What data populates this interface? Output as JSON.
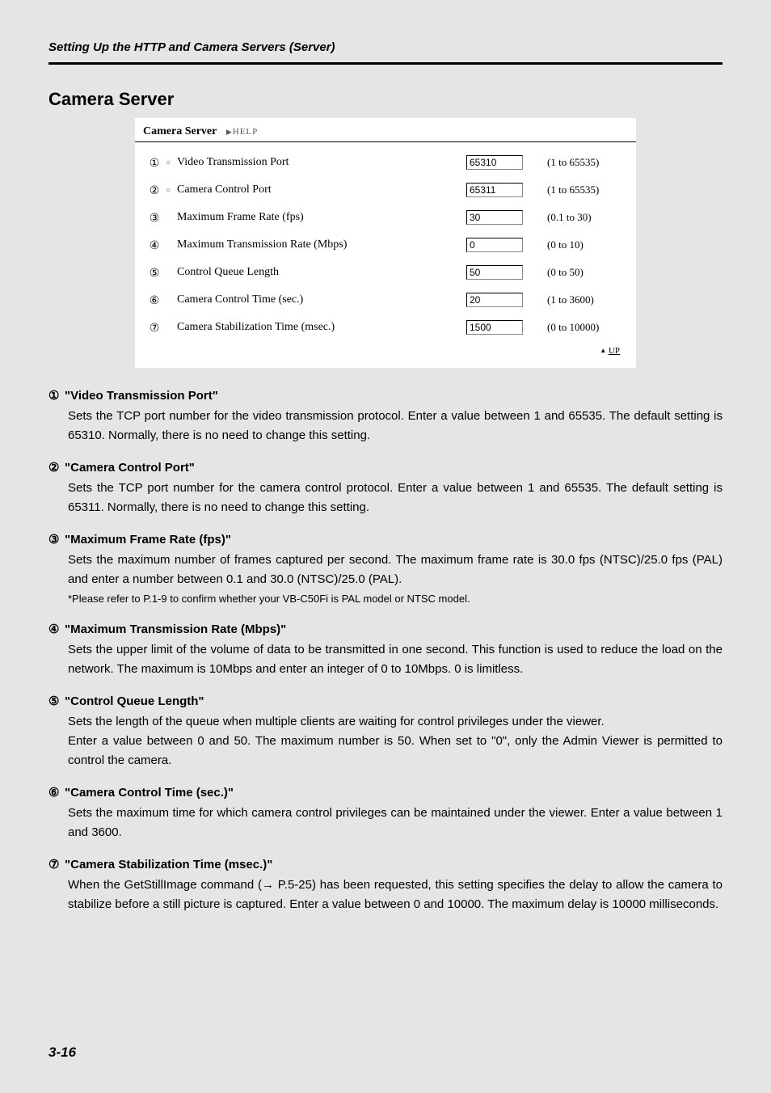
{
  "page": {
    "header": "Setting Up the HTTP and Camera Servers (Server)",
    "section_title": "Camera Server",
    "page_number": "3-16"
  },
  "screenshot": {
    "title": "Camera Server",
    "help_arrow": "▶",
    "help": "HELP",
    "up_arrow": "▲",
    "up": "UP",
    "rows": [
      {
        "num": "①",
        "bullet": "○",
        "label": "Video Transmission Port",
        "value": "65310",
        "range": "(1 to 65535)"
      },
      {
        "num": "②",
        "bullet": "○",
        "label": "Camera Control Port",
        "value": "65311",
        "range": "(1 to 65535)"
      },
      {
        "num": "③",
        "bullet": "",
        "label": "Maximum Frame Rate (fps)",
        "value": "30",
        "range": "(0.1 to 30)"
      },
      {
        "num": "④",
        "bullet": "",
        "label": "Maximum Transmission Rate (Mbps)",
        "value": "0",
        "range": "(0 to 10)"
      },
      {
        "num": "⑤",
        "bullet": "",
        "label": "Control Queue Length",
        "value": "50",
        "range": "(0 to 50)"
      },
      {
        "num": "⑥",
        "bullet": "",
        "label": "Camera Control Time (sec.)",
        "value": "20",
        "range": "(1 to 3600)"
      },
      {
        "num": "⑦",
        "bullet": "",
        "label": "Camera Stabilization Time (msec.)",
        "value": "1500",
        "range": "(0 to 10000)"
      }
    ]
  },
  "descriptions": [
    {
      "num": "①",
      "title": "\"Video Transmission Port\"",
      "body": "Sets the TCP port number for the video transmission protocol. Enter a value between 1 and 65535. The default setting is 65310. Normally, there is no need to change this setting."
    },
    {
      "num": "②",
      "title": "\"Camera Control Port\"",
      "body": "Sets the TCP port number for the camera control protocol. Enter a value between 1 and 65535. The default setting is 65311. Normally, there is no need to change this setting."
    },
    {
      "num": "③",
      "title": "\"Maximum Frame Rate (fps)\"",
      "body": "Sets the maximum number of frames captured per second. The maximum frame rate is 30.0 fps (NTSC)/25.0 fps (PAL) and enter a number between 0.1 and 30.0 (NTSC)/25.0 (PAL).",
      "note": "*Please refer to P.1-9 to confirm whether your VB-C50Fi is PAL model or NTSC model."
    },
    {
      "num": "④",
      "title": "\"Maximum Transmission Rate (Mbps)\"",
      "body": "Sets the upper limit of the volume of data to be transmitted in one second. This function is used to reduce the load on the network. The maximum is 10Mbps and enter an integer of 0 to 10Mbps. 0 is limitless."
    },
    {
      "num": "⑤",
      "title": "\"Control Queue Length\"",
      "body": "Sets the length of the queue when multiple clients are waiting for control privileges under the viewer.",
      "body2": "Enter a value between 0 and 50. The maximum number is 50. When set to \"0\", only the Admin Viewer is permitted to control the camera."
    },
    {
      "num": "⑥",
      "title": "\"Camera Control Time (sec.)\"",
      "body": "Sets the maximum time for which camera control privileges can be maintained under the viewer. Enter a value between 1 and 3600."
    },
    {
      "num": "⑦",
      "title": "\"Camera Stabilization Time (msec.)\"",
      "body": "When the GetStillImage command (→ P.5-25) has been requested, this setting specifies the delay to allow the camera to stabilize before a still picture is captured. Enter a value between 0 and 10000. The maximum delay is 10000 milliseconds."
    }
  ]
}
